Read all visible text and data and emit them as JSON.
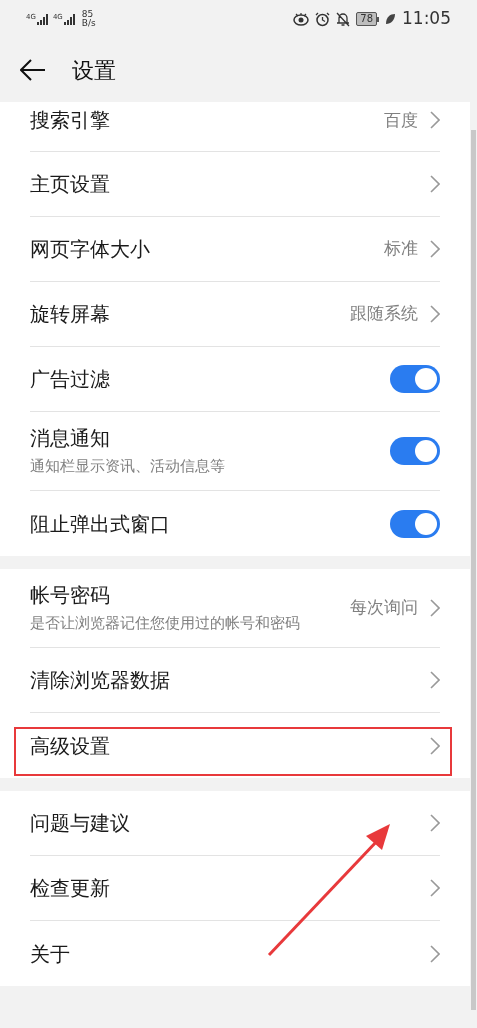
{
  "status_bar": {
    "networks": [
      "4G",
      "4G"
    ],
    "speed": "85",
    "speed_unit": "B/s",
    "battery": "78",
    "time": "11:05"
  },
  "header": {
    "title": "设置"
  },
  "sections": [
    {
      "items": [
        {
          "kind": "link",
          "label": "搜索引擎",
          "value": "百度"
        },
        {
          "kind": "link",
          "label": "主页设置"
        },
        {
          "kind": "link",
          "label": "网页字体大小",
          "value": "标准"
        },
        {
          "kind": "link",
          "label": "旋转屏幕",
          "value": "跟随系统"
        },
        {
          "kind": "toggle",
          "label": "广告过滤",
          "on": true
        },
        {
          "kind": "toggle",
          "label": "消息通知",
          "subtitle": "通知栏显示资讯、活动信息等",
          "on": true
        },
        {
          "kind": "toggle",
          "label": "阻止弹出式窗口",
          "on": true
        }
      ]
    },
    {
      "items": [
        {
          "kind": "link",
          "label": "帐号密码",
          "subtitle": "是否让浏览器记住您使用过的帐号和密码",
          "value": "每次询问",
          "highlighted": false
        },
        {
          "kind": "link",
          "label": "清除浏览器数据",
          "highlighted": false
        },
        {
          "kind": "link",
          "label": "高级设置",
          "highlighted": true
        }
      ]
    },
    {
      "items": [
        {
          "kind": "link",
          "label": "问题与建议"
        },
        {
          "kind": "link",
          "label": "检查更新"
        },
        {
          "kind": "link",
          "label": "关于"
        }
      ]
    }
  ]
}
